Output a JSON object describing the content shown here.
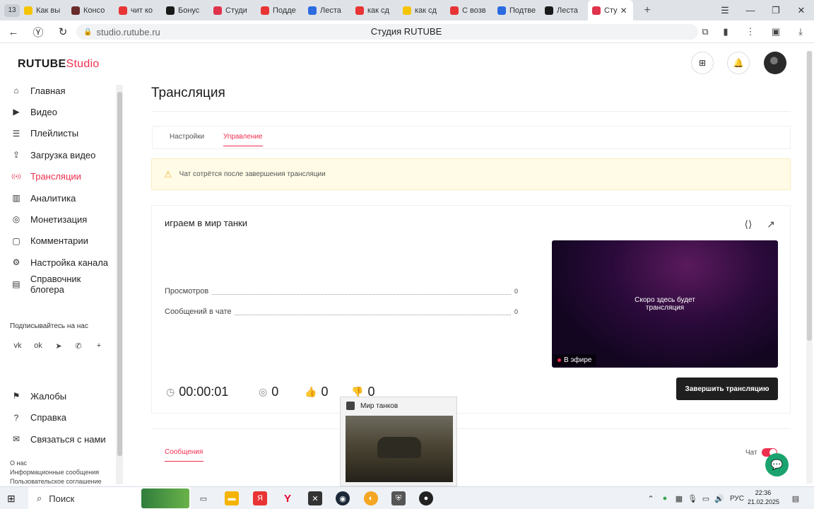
{
  "browser": {
    "tab_count": "13",
    "tabs": [
      {
        "label": "Как вы",
        "color": "#f5c400"
      },
      {
        "label": "Консо",
        "color": "#6a2b2b"
      },
      {
        "label": "чит ко",
        "color": "#e83434"
      },
      {
        "label": "Бонус",
        "color": "#1a1a1a"
      },
      {
        "label": "Студи",
        "color": "#e0334b"
      },
      {
        "label": "Подде",
        "color": "#e83434"
      },
      {
        "label": "Леста",
        "color": "#2c6be0"
      },
      {
        "label": "как сд",
        "color": "#e83434"
      },
      {
        "label": "как сд",
        "color": "#f5c400"
      },
      {
        "label": "С возв",
        "color": "#e83434"
      },
      {
        "label": "Подтве",
        "color": "#2c6be0"
      },
      {
        "label": "Леста",
        "color": "#1a1a1a"
      }
    ],
    "active_tab": {
      "label": "Сту",
      "color": "#e0334b"
    },
    "url": "studio.rutube.ru",
    "page_title": "Студия RUTUBE"
  },
  "app": {
    "logo_part1": "RUTUBE",
    "logo_part2": "Studio"
  },
  "sidebar": {
    "items": [
      {
        "label": "Главная",
        "icon": "home-icon"
      },
      {
        "label": "Видео",
        "icon": "video-icon"
      },
      {
        "label": "Плейлисты",
        "icon": "playlist-icon"
      },
      {
        "label": "Загрузка видео",
        "icon": "upload-icon"
      },
      {
        "label": "Трансляции",
        "icon": "broadcast-icon"
      },
      {
        "label": "Аналитика",
        "icon": "analytics-icon"
      },
      {
        "label": "Монетизация",
        "icon": "money-icon"
      },
      {
        "label": "Комментарии",
        "icon": "comments-icon"
      },
      {
        "label": "Настройка канала",
        "icon": "settings-icon"
      },
      {
        "label": "Справочник блогера",
        "icon": "book-icon"
      }
    ],
    "follow_title": "Подписывайтесь на нас",
    "bottom_items": [
      {
        "label": "Жалобы",
        "icon": "flag-icon"
      },
      {
        "label": "Справка",
        "icon": "help-icon"
      },
      {
        "label": "Связаться с нами",
        "icon": "mail-icon"
      }
    ],
    "footer_links": [
      "О нас",
      "Информационные сообщения",
      "Пользовательское соглашение"
    ]
  },
  "main": {
    "title": "Трансляция",
    "tabs": [
      "Настройки",
      "Управление"
    ],
    "alert": "Чат сотрётся после завершения трансляции",
    "stream_name": "играем в мир танки",
    "stats": [
      {
        "label": "Просмотров",
        "value": "0"
      },
      {
        "label": "Сообщений в чате",
        "value": "0"
      }
    ],
    "player_message_line1": "Скоро здесь будет",
    "player_message_line2": "трансляция",
    "live_badge": "В эфире",
    "duration": "00:00:01",
    "viewers": "0",
    "likes": "0",
    "dislikes": "0",
    "end_button": "Завершить трансляцию",
    "chat_tab": "Сообщения",
    "chat_toggle_label": "Чат"
  },
  "taskbar": {
    "search_placeholder": "Поиск",
    "thumbnail_title": "Мир танков",
    "language": "РУС",
    "time": "22:36",
    "date": "21.02.2025"
  }
}
